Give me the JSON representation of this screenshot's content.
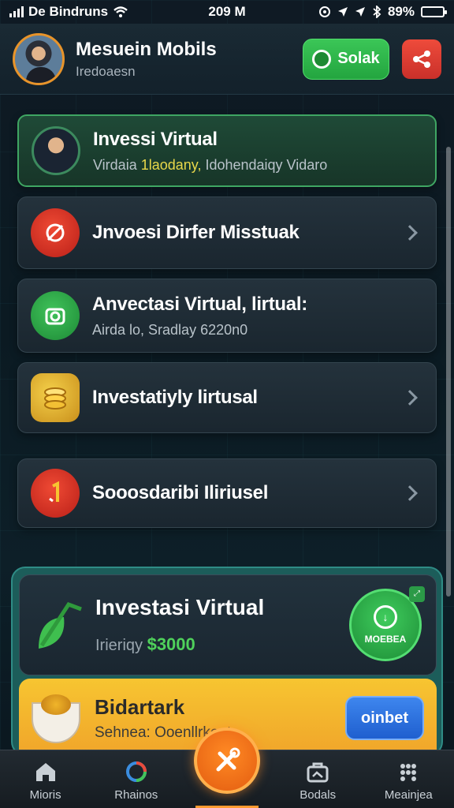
{
  "status": {
    "carrier": "De Bindruns",
    "time": "209 M",
    "battery": "89%"
  },
  "header": {
    "title": "Mesuein Mobils",
    "subtitle": "Iredoaesn",
    "solak_label": "Solak"
  },
  "list": [
    {
      "title": "Invessi Virtual",
      "sub_pre": "Virdaia ",
      "sub_hl": "1laodany,",
      "sub_post": " Idohendaiqy Vidaro"
    },
    {
      "title": "Jnvoesi Dirfer Misstuak"
    },
    {
      "title": "Anvectasi Virtual, lirtual:",
      "sub": "Airda lo, Sradlay 6220n0"
    },
    {
      "title": "Investatiyly lirtusal"
    },
    {
      "title": "Sooosdaribi Iliriusel"
    }
  ],
  "promo": {
    "title": "Investasi Virtual",
    "sub_label": "Irieriqy",
    "amount": "$3000",
    "button_label": "MOEBEA"
  },
  "banner": {
    "title": "Bidartark",
    "subtitle": "Sehnea: Ooenllrkent:",
    "button_label": "oinbet"
  },
  "tabs": [
    {
      "label": "Mioris"
    },
    {
      "label": "Rhainos"
    },
    {
      "label": "Bodals"
    },
    {
      "label": "Meainjea"
    }
  ],
  "colors": {
    "accent_green": "#3bc657",
    "accent_orange": "#ff8a24",
    "danger_red": "#ee4b3b",
    "banner_yellow": "#f7c531",
    "button_blue": "#3e86ee"
  }
}
